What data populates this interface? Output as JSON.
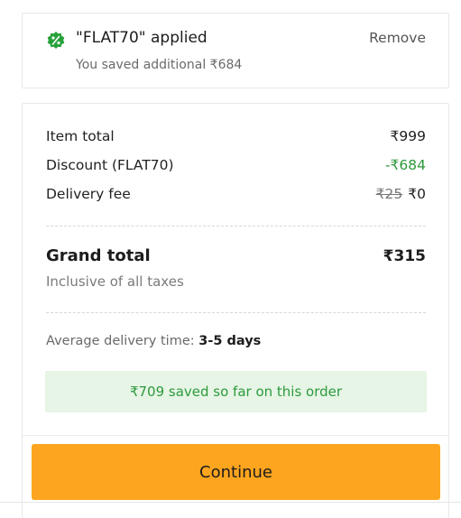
{
  "coupon": {
    "icon": "discount-badge-icon",
    "title": "\"FLAT70\" applied",
    "saved_text": "You saved additional ₹684",
    "remove_label": "Remove"
  },
  "summary": {
    "item_total_label": "Item total",
    "item_total_value": "₹999",
    "discount_label": "Discount (FLAT70)",
    "discount_value": "-₹684",
    "delivery_label": "Delivery fee",
    "delivery_original": "₹25",
    "delivery_value": "₹0",
    "grand_total_label": "Grand total",
    "grand_total_value": "₹315",
    "taxes_note": "Inclusive of all taxes",
    "delivery_time_label": "Average delivery time:",
    "delivery_time_value": "3-5 days",
    "savings_banner": "₹709 saved so far on this order"
  },
  "actions": {
    "continue_label": "Continue"
  },
  "colors": {
    "accent_green": "#2e9a3c",
    "continue_orange": "#fda51f",
    "banner_bg": "#e6f5e6"
  }
}
